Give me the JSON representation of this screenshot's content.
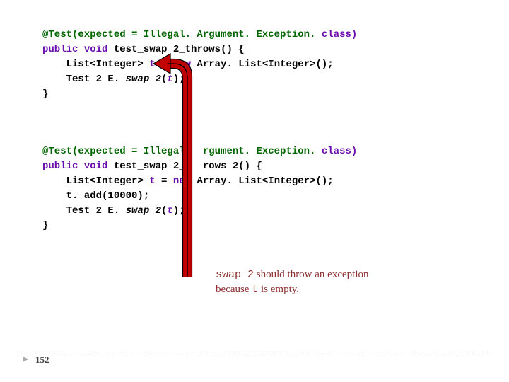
{
  "code": {
    "block1": {
      "line1_a": "@Test(expected = Illegal. Argument. Exception.",
      "line1_b": " class)",
      "line2_a": "public",
      "line2_b": " void",
      "line2_c": " test_swap 2_throws() ",
      "line2_d": "{",
      "line3_a": "    List<Integer> ",
      "line3_b": "t",
      "line3_c": " = ",
      "line3_d": "new",
      "line3_e": " Array. List<Integer>();",
      "line4_a": "    Test 2 E. ",
      "line4_b": "swap 2",
      "line4_c": "(",
      "line4_d": "t",
      "line4_e": "); ",
      "line5": "}"
    },
    "block2": {
      "line1_a": "@Test(expected = Illegal.  rgument. Exception.",
      "line1_b": " class)",
      "line2_a": "public",
      "line2_b": " void",
      "line2_c": " test_swap 2_t  rows 2() ",
      "line2_d": "{",
      "line3_a": "    List<Integer> ",
      "line3_b": "t",
      "line3_c": " = ",
      "line3_d": "ne ",
      "line3_e": " Array. List<Integer>();",
      "line4_a": "    t. add(10000);",
      "line5_a": "    Test 2 E. ",
      "line5_b": "swap 2",
      "line5_c": "(",
      "line5_d": "t",
      "line5_e": "); ",
      "line6": "}"
    }
  },
  "annotation": {
    "line1_a": "swap 2",
    "line1_b": " should throw an exception",
    "line2_a": "because ",
    "line2_b": "t",
    "line2_c": " is empty."
  },
  "page_number": "152"
}
